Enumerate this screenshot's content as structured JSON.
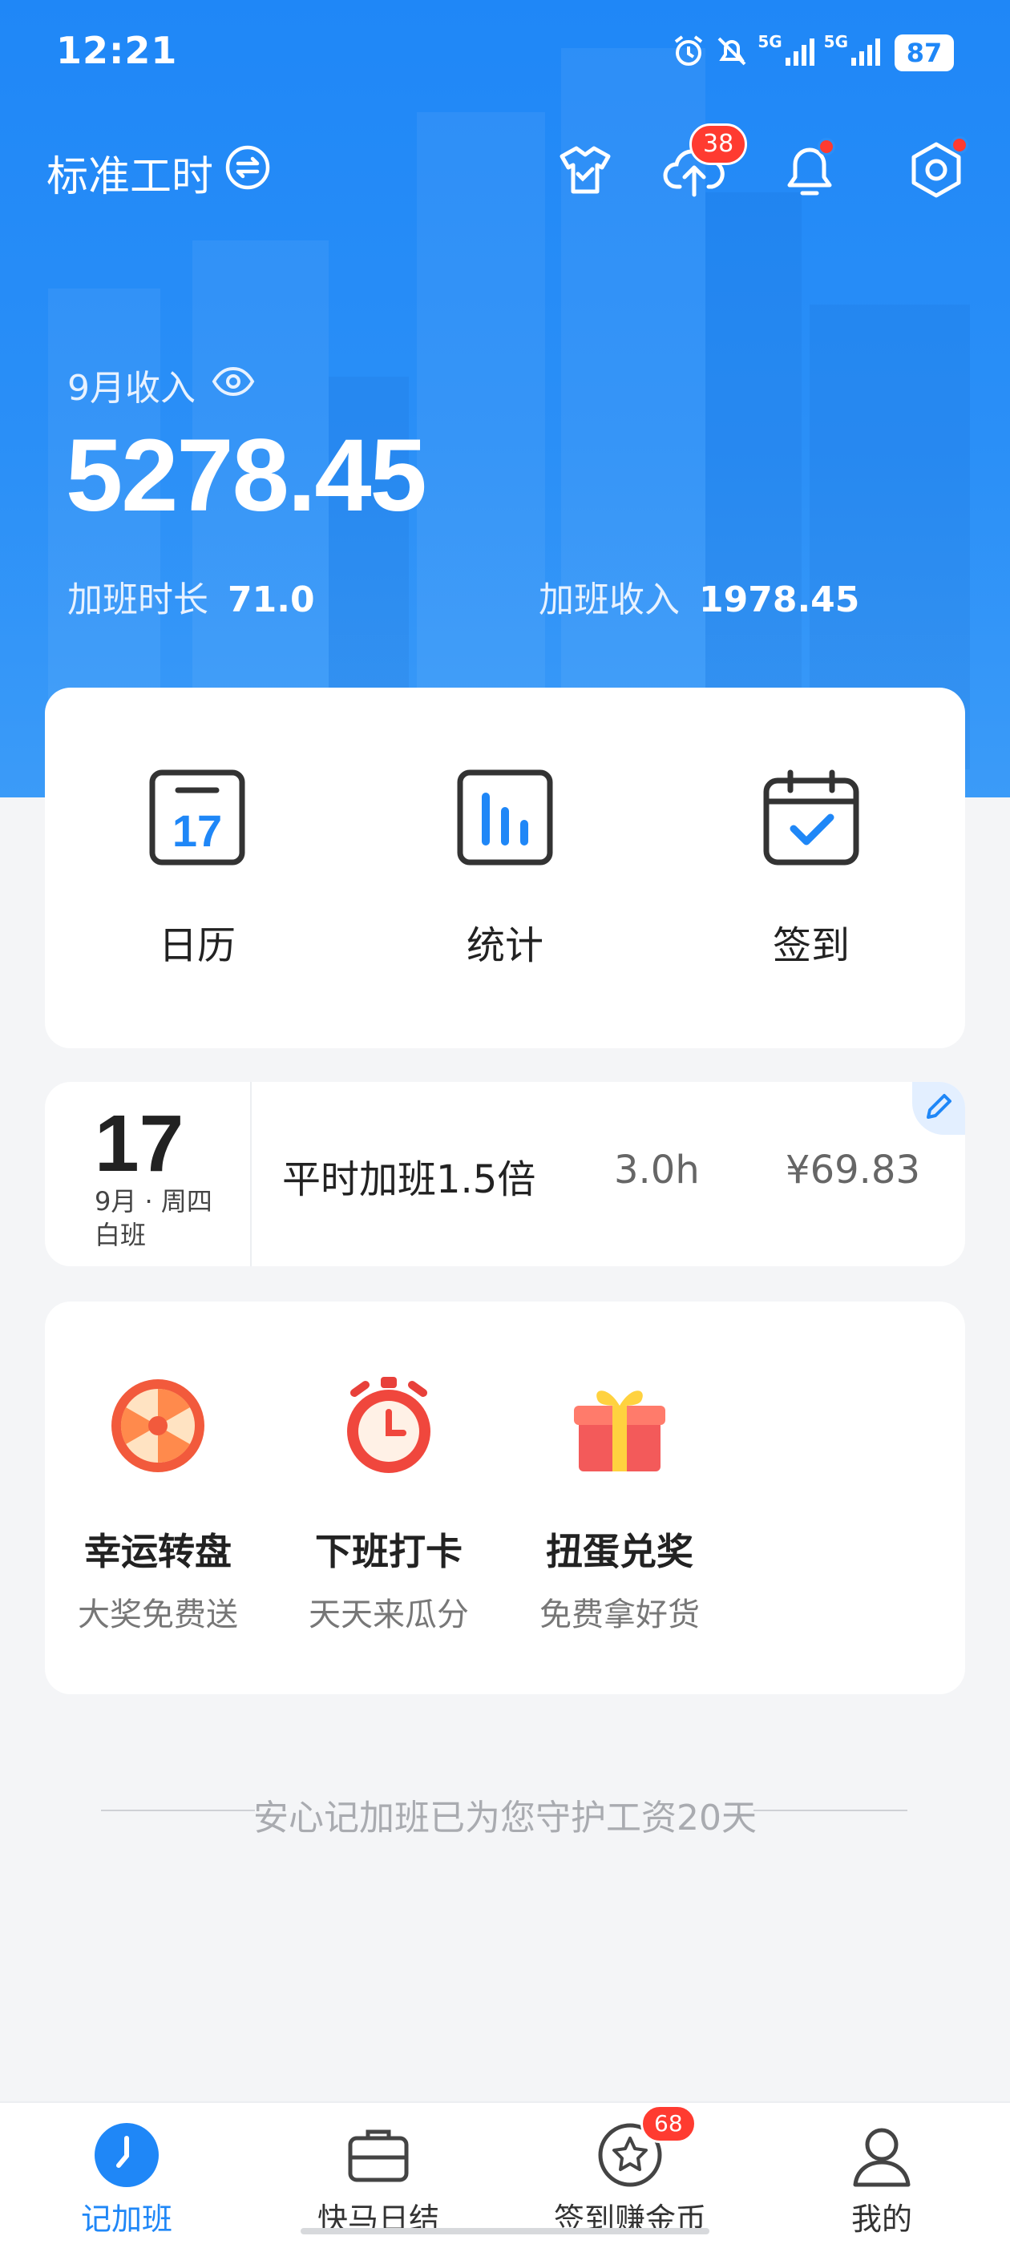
{
  "status_bar": {
    "time": "12:21",
    "network_1": "5G",
    "network_2": "5G",
    "battery": "87"
  },
  "header": {
    "mode_title": "标准工时",
    "cloud_badge": "38",
    "icons": [
      "shirt-icon",
      "cloud-upload-icon",
      "bell-icon",
      "settings-icon"
    ]
  },
  "income": {
    "label": "9月收入",
    "amount": "5278.45",
    "overtime_hours_label": "加班时长",
    "overtime_hours_value": "71.0",
    "overtime_income_label": "加班收入",
    "overtime_income_value": "1978.45"
  },
  "quick_actions": [
    {
      "label": "日历",
      "icon": "calendar-17-icon"
    },
    {
      "label": "统计",
      "icon": "bar-chart-icon"
    },
    {
      "label": "签到",
      "icon": "calendar-check-icon"
    }
  ],
  "record": {
    "day": "17",
    "weekday": "9月 · 周四",
    "shift": "白班",
    "type": "平时加班1.5倍",
    "hours": "3.0h",
    "amount": "¥69.83"
  },
  "promos": [
    {
      "title": "幸运转盘",
      "desc": "大奖免费送",
      "icon": "wheel-icon"
    },
    {
      "title": "下班打卡",
      "desc": "天天来瓜分",
      "icon": "stopwatch-icon"
    },
    {
      "title": "扭蛋兑奖",
      "desc": "免费拿好货",
      "icon": "gift-icon"
    }
  ],
  "footer_note": "安心记加班已为您守护工资20天",
  "tabbar": {
    "tabs": [
      {
        "label": "记加班",
        "icon": "clock-icon",
        "active": true
      },
      {
        "label": "快马日结",
        "icon": "briefcase-icon"
      },
      {
        "label": "签到赚金币",
        "icon": "star-coin-icon",
        "badge": "68"
      },
      {
        "label": "我的",
        "icon": "user-icon"
      }
    ]
  },
  "colors": {
    "primary": "#1f87f7",
    "badge_red": "#ff3b30",
    "background": "#f4f5f7"
  }
}
